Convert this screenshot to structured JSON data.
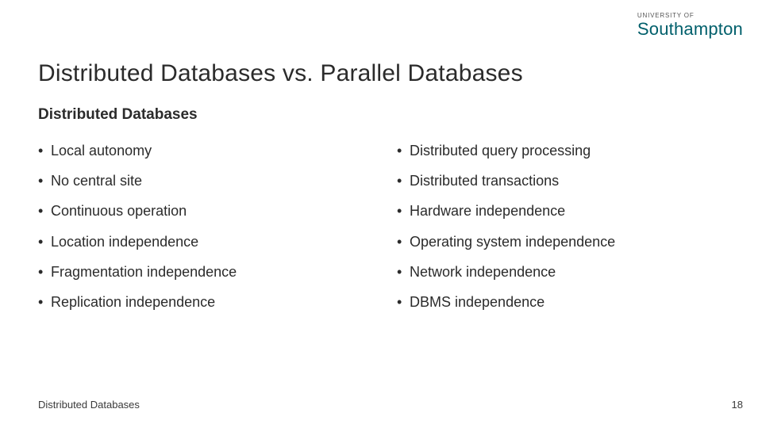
{
  "logo": {
    "line1": "UNIVERSITY OF",
    "line2_main": "Southampton"
  },
  "title": "Distributed Databases vs. Parallel Databases",
  "subtitle": "Distributed Databases",
  "columns": {
    "left": [
      "Local autonomy",
      "No central site",
      "Continuous operation",
      "Location independence",
      "Fragmentation independence",
      "Replication independence"
    ],
    "right": [
      "Distributed query processing",
      "Distributed transactions",
      "Hardware independence",
      "Operating system independence",
      "Network independence",
      "DBMS independence"
    ]
  },
  "footer": {
    "left": "Distributed Databases",
    "page": "18"
  }
}
